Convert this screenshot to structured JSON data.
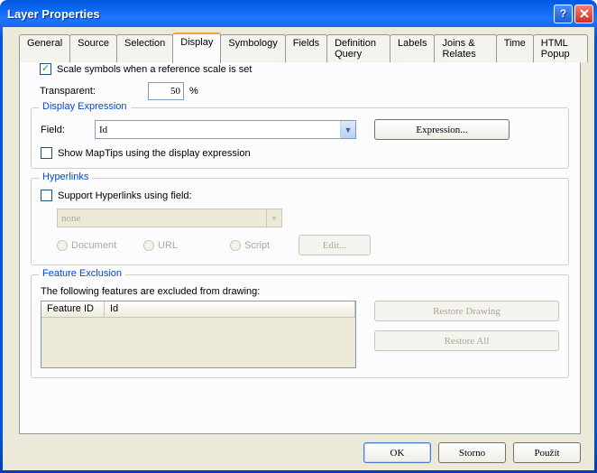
{
  "title": "Layer Properties",
  "tabs": [
    "General",
    "Source",
    "Selection",
    "Display",
    "Symbology",
    "Fields",
    "Definition Query",
    "Labels",
    "Joins & Relates",
    "Time",
    "HTML Popup"
  ],
  "activeTab": "Display",
  "scale_symbols_label": "Scale symbols when a reference scale is set",
  "scale_symbols_checked": true,
  "transparent_label": "Transparent:",
  "transparent_value": "50",
  "transparent_unit": "%",
  "display_expression": {
    "title": "Display Expression",
    "field_label": "Field:",
    "field_value": "Id",
    "expression_btn": "Expression...",
    "maptips_label": "Show MapTips using the display expression",
    "maptips_checked": false
  },
  "hyperlinks": {
    "title": "Hyperlinks",
    "support_label": "Support Hyperlinks using field:",
    "support_checked": false,
    "field_value": "none",
    "radio_document": "Document",
    "radio_url": "URL",
    "radio_script": "Script",
    "edit_btn": "Edit..."
  },
  "feature_exclusion": {
    "title": "Feature Exclusion",
    "desc": "The following features are excluded from drawing:",
    "col1": "Feature ID",
    "col2": "Id",
    "restore_drawing": "Restore Drawing",
    "restore_all": "Restore All"
  },
  "buttons": {
    "ok": "OK",
    "cancel": "Storno",
    "apply": "Použít"
  }
}
